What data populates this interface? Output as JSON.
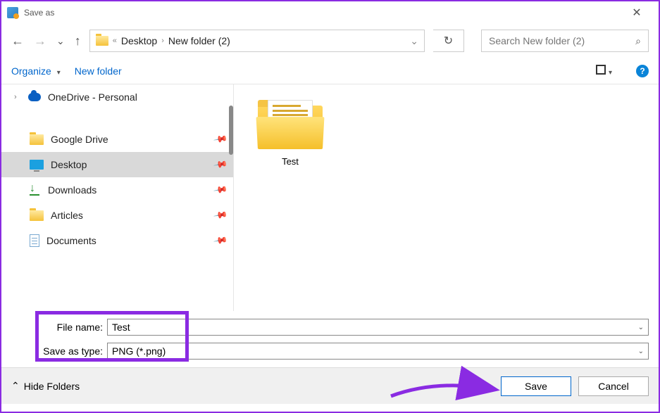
{
  "window": {
    "title": "Save as"
  },
  "nav": {
    "breadcrumb": {
      "sep": "«",
      "part1": "Desktop",
      "part2": "New folder (2)"
    },
    "search_placeholder": "Search New folder (2)"
  },
  "toolbar": {
    "organize": "Organize",
    "new_folder": "New folder"
  },
  "sidebar": {
    "onedrive": "OneDrive - Personal",
    "items": [
      {
        "label": "Google Drive"
      },
      {
        "label": "Desktop"
      },
      {
        "label": "Downloads"
      },
      {
        "label": "Articles"
      },
      {
        "label": "Documents"
      }
    ]
  },
  "content": {
    "folder_name": "Test"
  },
  "fields": {
    "filename_label": "File name:",
    "filename_value": "Test",
    "savetype_label": "Save as type:",
    "savetype_value": "PNG (*.png)"
  },
  "footer": {
    "hide_folders": "Hide Folders",
    "save": "Save",
    "cancel": "Cancel"
  }
}
